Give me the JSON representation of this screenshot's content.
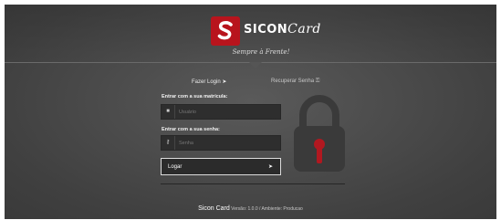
{
  "brand": {
    "logo_text": "SICON",
    "logo_script": "Card",
    "slogan": "Sempre à Frente!"
  },
  "tabs": {
    "login_label": "Fazer Login",
    "recover_label": "Recuperar Senha"
  },
  "form": {
    "user_label": "Entrar com a sua matrícula:",
    "user_placeholder": "Usuário",
    "pass_label": "Entrar com a sua senha:",
    "pass_placeholder": "Senha",
    "login_button": "Logar"
  },
  "footer": {
    "brand": "Sicon Card",
    "version": "Versão: 1.0.0 / Ambiente: Producao"
  },
  "icons": {
    "login": "sign-in-icon",
    "recover": "key-icon",
    "user": "user-icon",
    "password": "key-icon",
    "lock": "padlock-icon"
  },
  "colors": {
    "background": "#4c4c4c",
    "logo_red": "#b8141d",
    "lock_keyhole": "#b11820"
  }
}
